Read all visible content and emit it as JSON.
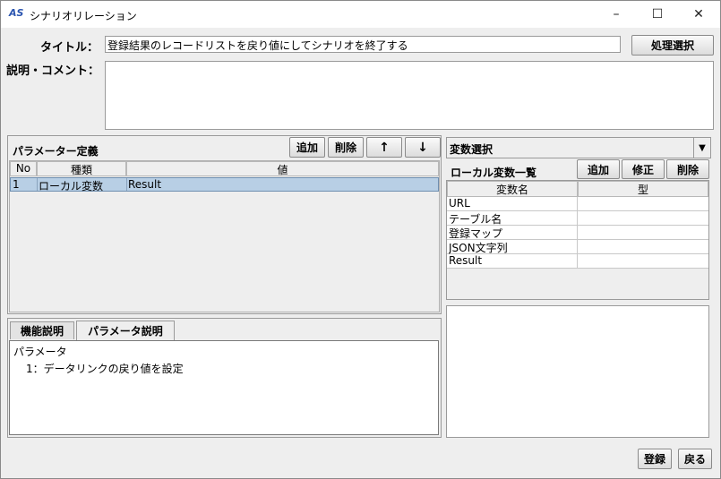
{
  "window": {
    "title": "シナリオリレーション",
    "icon_text": "AS",
    "controls": {
      "minimize": "–",
      "maximize": "☐",
      "close": "✕"
    }
  },
  "form": {
    "title_label": "タイトル：",
    "title_value": "登録結果のレコードリストを戻り値にしてシナリオを終了する",
    "process_select_label": "処理選択",
    "comment_label": "説明・コメント：",
    "comment_value": ""
  },
  "params": {
    "heading": "パラメーター定義",
    "buttons": {
      "add": "追加",
      "delete": "削除",
      "up": "↑",
      "down": "↓"
    },
    "columns": [
      "No",
      "種類",
      "値"
    ],
    "rows": [
      {
        "no": "1",
        "type": "ローカル変数",
        "value": "Result"
      }
    ]
  },
  "desc_tabs": {
    "tabs": [
      "機能説明",
      "パラメータ説明"
    ],
    "active": "パラメータ説明",
    "content_title": "パラメータ",
    "content_line": "1：データリンクの戻り値を設定"
  },
  "vars": {
    "selector_label": "変数選択",
    "list_heading": "ローカル変数一覧",
    "buttons": {
      "add": "追加",
      "edit": "修正",
      "delete": "削除"
    },
    "columns": [
      "変数名",
      "型"
    ],
    "rows": [
      {
        "name": "URL",
        "type": ""
      },
      {
        "name": "テーブル名",
        "type": ""
      },
      {
        "name": "登録マップ",
        "type": ""
      },
      {
        "name": "JSON文字列",
        "type": ""
      },
      {
        "name": "Result",
        "type": ""
      }
    ]
  },
  "footer": {
    "register": "登録",
    "back": "戻る"
  }
}
